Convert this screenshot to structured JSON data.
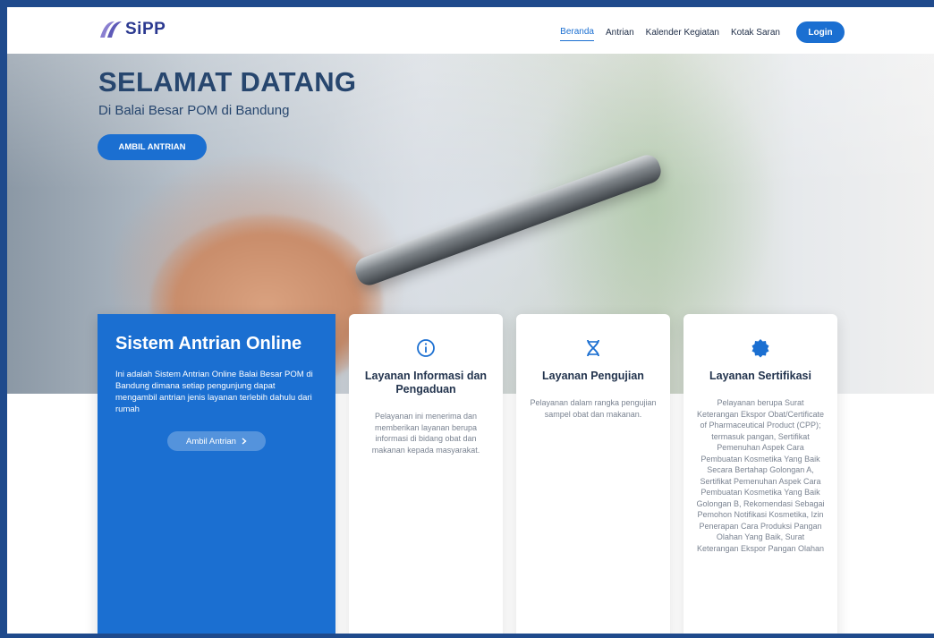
{
  "nav": {
    "logo_text": "SiPP",
    "links": [
      "Beranda",
      "Antrian",
      "Kalender Kegiatan",
      "Kotak Saran"
    ],
    "login_label": "Login"
  },
  "hero": {
    "title": "SELAMAT DATANG",
    "subtitle": "Di Balai Besar POM di Bandung",
    "button_label": "AMBIL ANTRIAN"
  },
  "intro_card": {
    "title": "Sistem Antrian Online",
    "text": "Ini adalah Sistem Antrian Online Balai Besar POM di Bandung dimana setiap pengunjung dapat mengambil antrian jenis layanan terlebih dahulu dari rumah",
    "button_label": "Ambil Antrian",
    "button_icon": "chevron-right-icon"
  },
  "services": [
    {
      "icon": "info-icon",
      "title": "Layanan Informasi dan Pengaduan",
      "text": "Pelayanan ini menerima dan memberikan layanan berupa informasi di bidang obat dan makanan kepada masyarakat."
    },
    {
      "icon": "dna-icon",
      "title": "Layanan Pengujian",
      "text": "Pelayanan dalam rangka pengujian sampel obat dan makanan."
    },
    {
      "icon": "badge-icon",
      "title": "Layanan Sertifikasi",
      "text": "Pelayanan berupa Surat Keterangan Ekspor Obat/Certificate of Pharmaceutical Product (CPP); termasuk pangan, Sertifikat Pemenuhan Aspek Cara Pembuatan Kosmetika Yang Baik Secara Bertahap Golongan A, Sertifikat Pemenuhan Aspek Cara Pembuatan Kosmetika Yang Baik Golongan B, Rekomendasi Sebagai Pemohon Notifikasi Kosmetika, Izin Penerapan Cara Produksi Pangan Olahan Yang Baik, Surat Keterangan Ekspor Pangan Olahan"
    }
  ],
  "colors": {
    "primary": "#1b6fd1",
    "heading": "#27466e",
    "frame": "#1f4a8c",
    "logo": "#2b3990"
  }
}
